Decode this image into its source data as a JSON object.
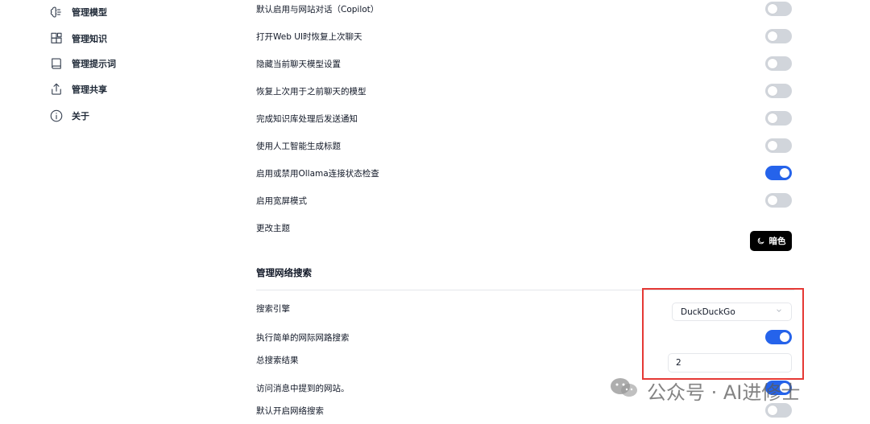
{
  "sidebar": {
    "items": [
      {
        "label": "管理模型",
        "icon": "brain-icon"
      },
      {
        "label": "管理知识",
        "icon": "blocks-icon"
      },
      {
        "label": "管理提示词",
        "icon": "book-icon"
      },
      {
        "label": "管理共享",
        "icon": "share-icon"
      },
      {
        "label": "关于",
        "icon": "info-icon"
      }
    ]
  },
  "settings": {
    "rows": [
      {
        "label": "默认启用与网站对话（Copilot）",
        "enabled": false
      },
      {
        "label": "打开Web UI时恢复上次聊天",
        "enabled": false
      },
      {
        "label": "隐藏当前聊天模型设置",
        "enabled": false
      },
      {
        "label": "恢复上次用于之前聊天的模型",
        "enabled": false
      },
      {
        "label": "完成知识库处理后发送通知",
        "enabled": false
      },
      {
        "label": "使用人工智能生成标题",
        "enabled": false
      },
      {
        "label": "启用或禁用Ollama连接状态检查",
        "enabled": true
      },
      {
        "label": "启用宽屏模式",
        "enabled": false
      }
    ],
    "theme": {
      "label": "更改主题",
      "button_label": "暗色"
    }
  },
  "web_search": {
    "section_title": "管理网络搜索",
    "engine_label": "搜索引擎",
    "engine_value": "DuckDuckGo",
    "simple_search_label": "执行简单的网际网路搜索",
    "simple_search_enabled": true,
    "total_results_label": "总搜索结果",
    "total_results_value": "2",
    "visit_sites_label": "访问消息中提到的网站。",
    "visit_sites_enabled": true,
    "default_web_search_label": "默认开启网络搜索",
    "default_web_search_enabled": false
  },
  "watermark": {
    "text": "公众号 · AI进修士"
  },
  "colors": {
    "accent": "#2563eb",
    "toggle_off": "#d1d5db",
    "highlight": "#e53935"
  }
}
